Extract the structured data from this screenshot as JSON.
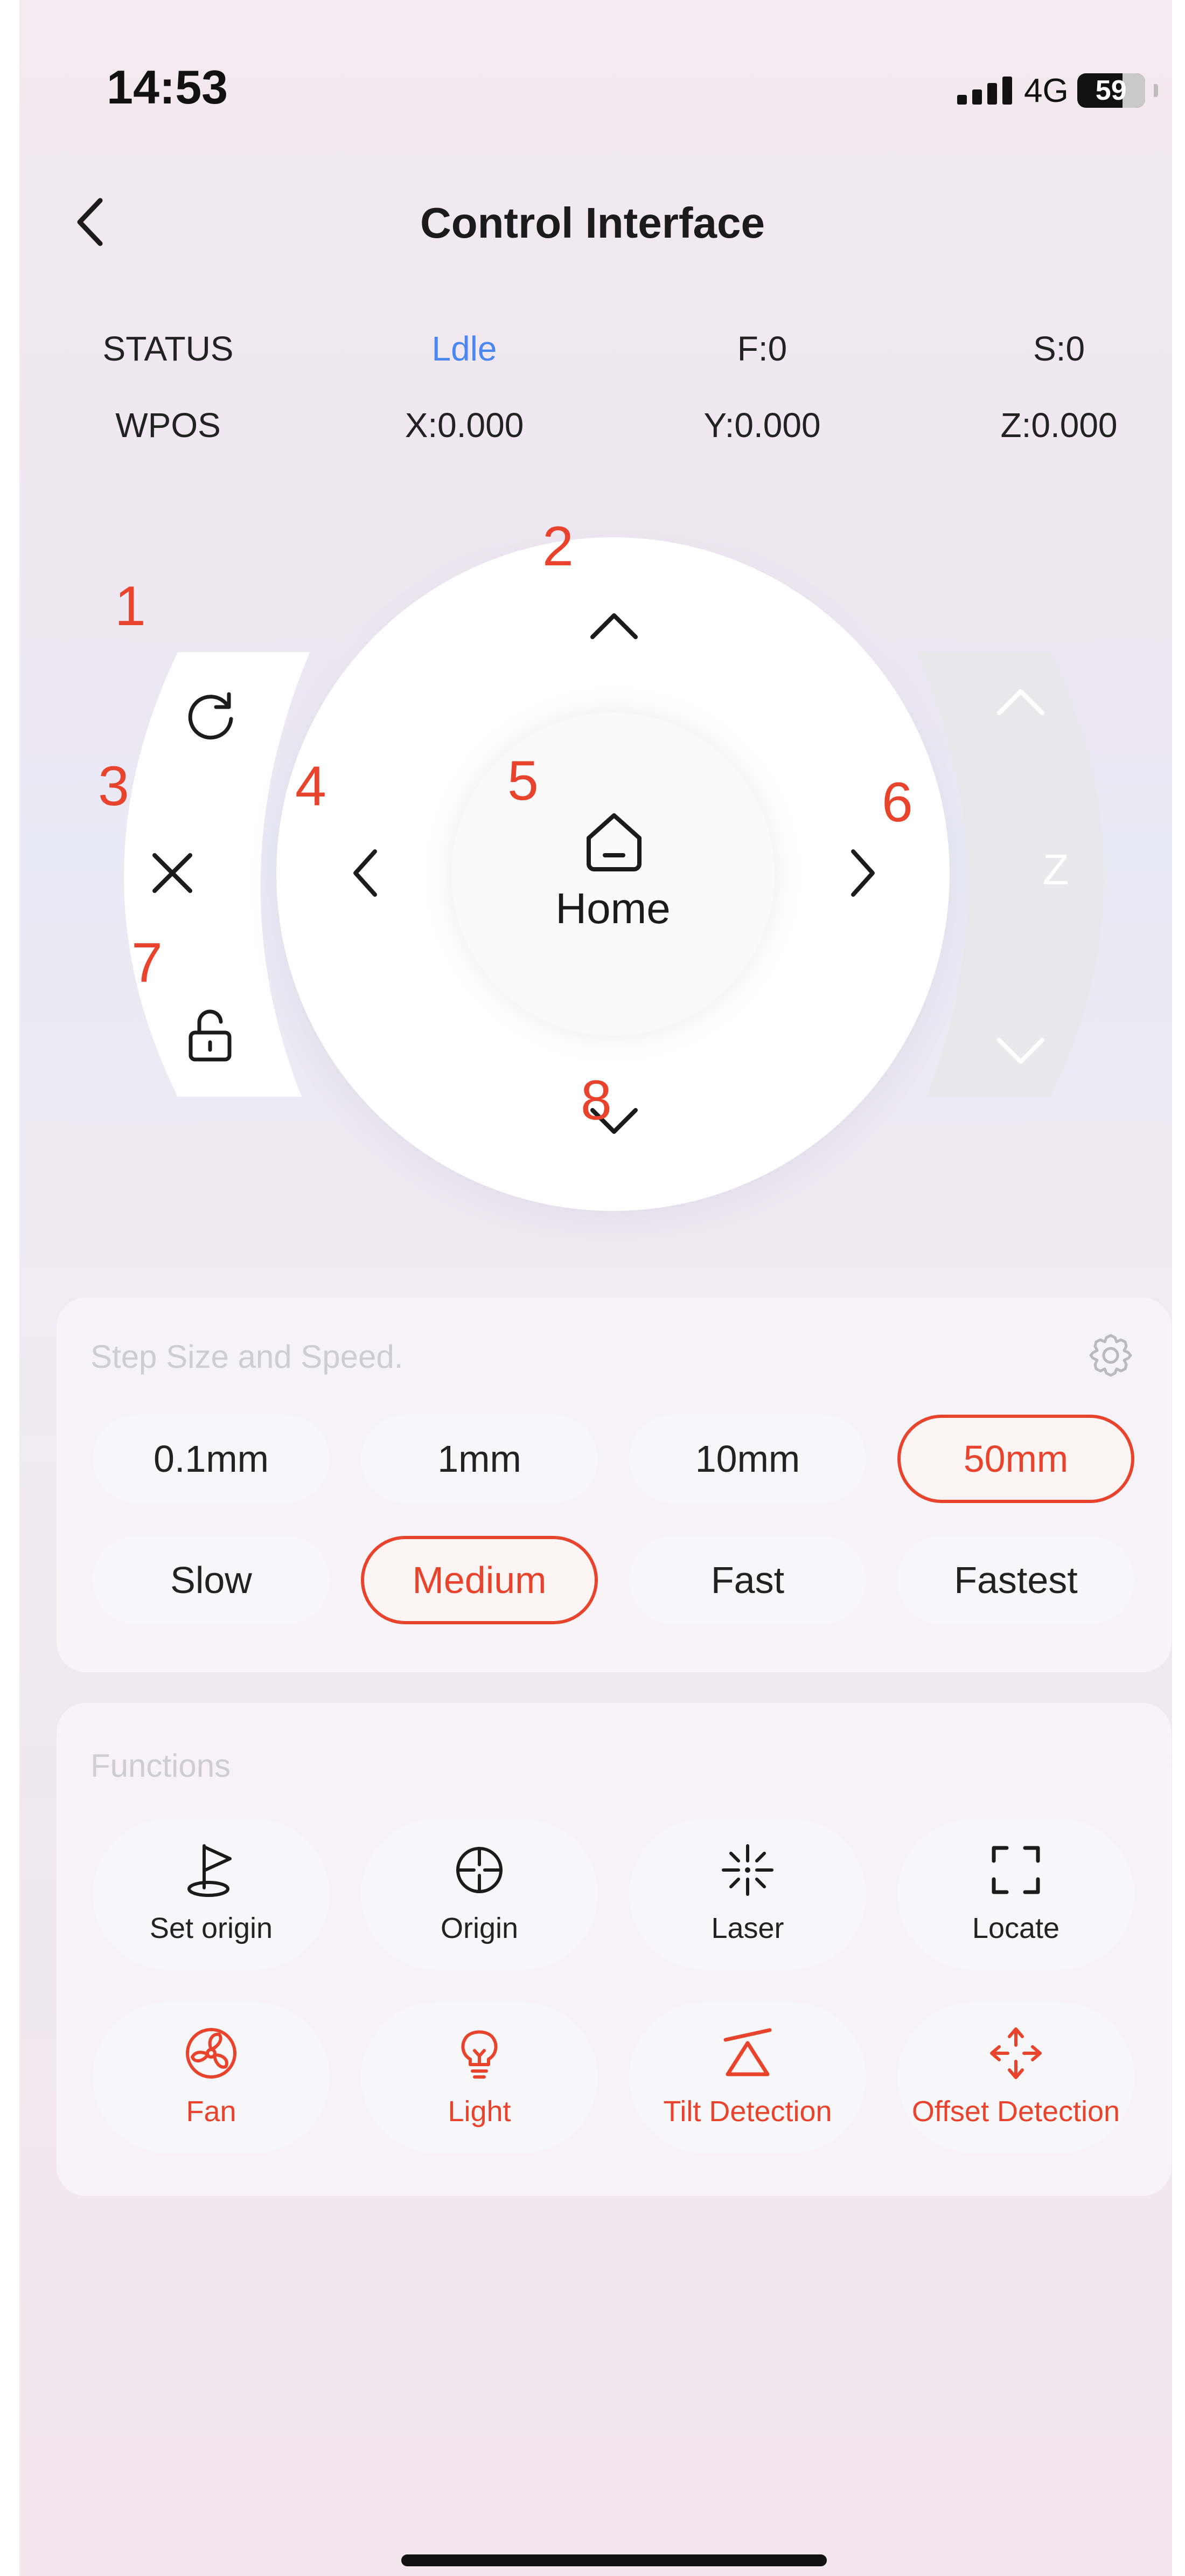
{
  "status_bar": {
    "time": "14:53",
    "network": "4G",
    "battery": "59"
  },
  "header": {
    "title": "Control Interface"
  },
  "status": {
    "row1": [
      "STATUS",
      "Ldle",
      "F:0",
      "S:0"
    ],
    "row2": [
      "WPOS",
      "X:0.000",
      "Y:0.000",
      "Z:0.000"
    ]
  },
  "jog": {
    "home_label": "Home",
    "z_label": "Z"
  },
  "annotations": [
    "1",
    "2",
    "3",
    "4",
    "5",
    "6",
    "7",
    "8"
  ],
  "step_panel": {
    "title": "Step Size and Speed.",
    "step_sizes": [
      "0.1mm",
      "1mm",
      "10mm",
      "50mm"
    ],
    "selected_step": "50mm",
    "speeds": [
      "Slow",
      "Medium",
      "Fast",
      "Fastest"
    ],
    "selected_speed": "Medium"
  },
  "functions": {
    "title": "Functions",
    "items": [
      {
        "label": "Set origin",
        "icon": "flag-origin-icon"
      },
      {
        "label": "Origin",
        "icon": "crosshair-icon"
      },
      {
        "label": "Laser",
        "icon": "laser-burst-icon"
      },
      {
        "label": "Locate",
        "icon": "locate-frame-icon"
      },
      {
        "label": "Fan",
        "icon": "fan-icon"
      },
      {
        "label": "Light",
        "icon": "bulb-icon"
      },
      {
        "label": "Tilt Detection",
        "icon": "tilt-icon"
      },
      {
        "label": "Offset Detection",
        "icon": "offset-arrows-icon"
      }
    ]
  },
  "colors": {
    "accent": "#e8432c",
    "status_blue": "#4a87f2",
    "text": "#1b1b1b"
  }
}
